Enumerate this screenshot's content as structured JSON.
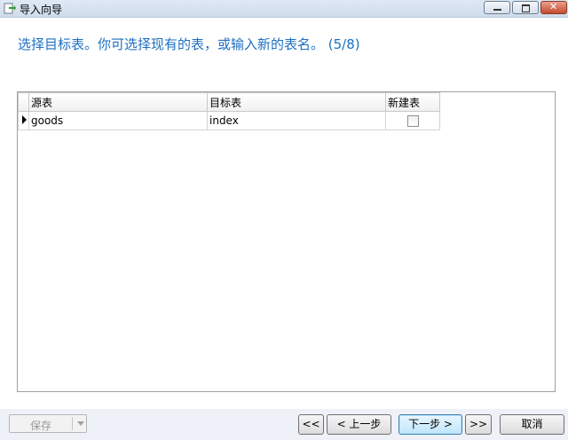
{
  "window": {
    "title": "导入向导",
    "icons": {
      "app": "import-wizard-icon",
      "minimize": "minimize-icon",
      "maximize": "maximize-icon",
      "close": "close-icon"
    }
  },
  "heading": "选择目标表。你可选择现有的表，或输入新的表名。 (5/8)",
  "table": {
    "columns": [
      "源表",
      "目标表",
      "新建表"
    ],
    "rows": [
      {
        "source": "goods",
        "target": "index",
        "new_table": false
      }
    ]
  },
  "footer": {
    "save_label": "保存",
    "first_label": "<<",
    "prev_label": "< 上一步",
    "next_label": "下一步 >",
    "last_label": ">>",
    "cancel_label": "取消"
  },
  "colors": {
    "heading": "#1d6fc2"
  }
}
